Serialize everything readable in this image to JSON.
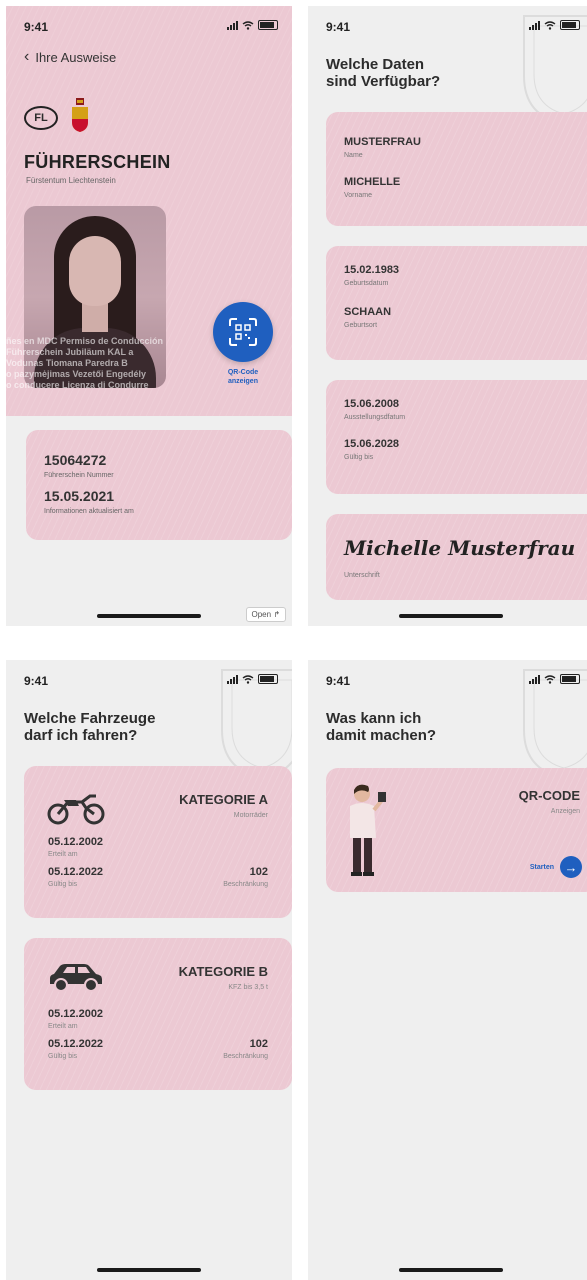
{
  "status_time": "9:41",
  "screen1": {
    "back_label": "Ihre Ausweise",
    "fl_badge": "FL",
    "title": "FÜHRERSCHEIN",
    "subtitle": "Fürstentum Liechtenstein",
    "microtext_lines": [
      "ñes en MDC  Permiso de Conducción",
      "Führerschein  Jubiläum  KAL a",
      "Vodunas  Tiomana  Paredra  B",
      "o pazymėjimas  Vezetői Engedély",
      "o conducere  Licenza di Condurre"
    ],
    "qr_label_line1": "QR-Code",
    "qr_label_line2": "anzeigen",
    "license_number": "15064272",
    "license_number_label": "Führerschein Nummer",
    "updated_date": "15.05.2021",
    "updated_label": "Informationen aktualisiert am",
    "open_button": "Open ↱"
  },
  "screen2": {
    "heading_line1": "Welche Daten",
    "heading_line2": "sind Verfügbar?",
    "card1": {
      "v1": "MUSTERFRAU",
      "l1": "Name",
      "v2": "MICHELLE",
      "l2": "Vorname"
    },
    "card2": {
      "v1": "15.02.1983",
      "l1": "Geburtsdatum",
      "v2": "SCHAAN",
      "l2": "Geburtsort"
    },
    "card3": {
      "v1": "15.06.2008",
      "l1": "Ausstellungsdfatum",
      "v2": "15.06.2028",
      "l2": "Gültig bis"
    },
    "card4": {
      "signature": "Michelle Musterfrau",
      "label": "Unterschrift"
    }
  },
  "screen3": {
    "heading_line1": "Welche Fahrzeuge",
    "heading_line2": "darf ich fahren?",
    "cards": [
      {
        "category": "KATEGORIE A",
        "sub": "Motorräder",
        "issued": "05.12.2002",
        "issued_label": "Erteilt am",
        "valid": "05.12.2022",
        "valid_label": "Gültig bis",
        "restriction": "102",
        "restriction_label": "Beschränkung",
        "icon": "motorcycle-icon"
      },
      {
        "category": "KATEGORIE B",
        "sub": "KFZ bis 3,5 t",
        "issued": "05.12.2002",
        "issued_label": "Erteilt am",
        "valid": "05.12.2022",
        "valid_label": "Gültig bis",
        "restriction": "102",
        "restriction_label": "Beschränkung",
        "icon": "car-icon"
      }
    ]
  },
  "screen4": {
    "heading_line1": "Was kann ich",
    "heading_line2": "damit machen?",
    "card_title": "QR-CODE",
    "card_sub": "Anzeigen",
    "start_label": "Starten"
  },
  "colors": {
    "accent": "#1f5fbf",
    "card_pink": "#ecc9d3",
    "background": "#efefef"
  }
}
